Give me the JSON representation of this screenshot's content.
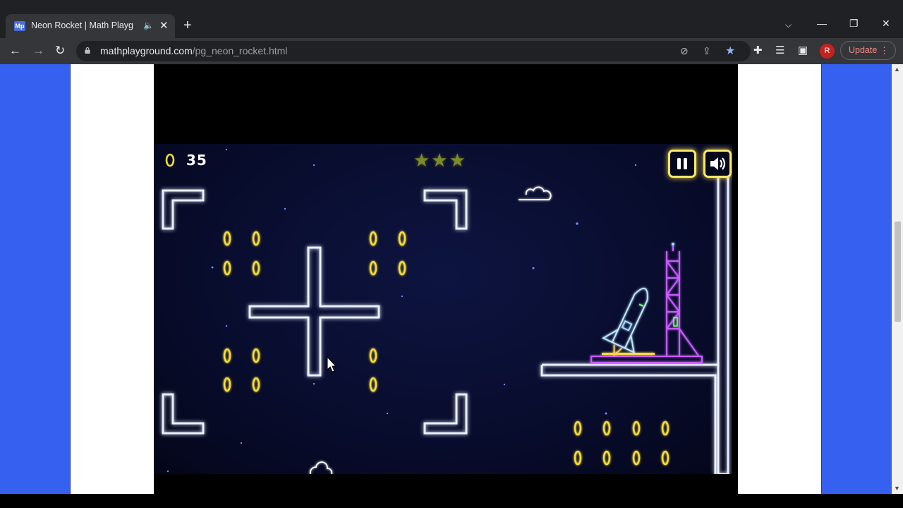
{
  "browser": {
    "tab_title": "Neon Rocket | Math Playgrou",
    "favicon_text": "Mp",
    "url_host": "mathplayground.com",
    "url_path": "/pg_neon_rocket.html",
    "profile_initial": "R",
    "update_label": "Update"
  },
  "game": {
    "coin_count": "35",
    "stars_display": "★★★",
    "pause_icon": "pause-icon",
    "sound_icon": "speaker-icon"
  },
  "colors": {
    "page_bg": "#3661f0",
    "neon_wall": "#ffffff",
    "coin": "#f5dc3a",
    "tower": "#c85cff",
    "rocket": "#bfe8ff"
  }
}
